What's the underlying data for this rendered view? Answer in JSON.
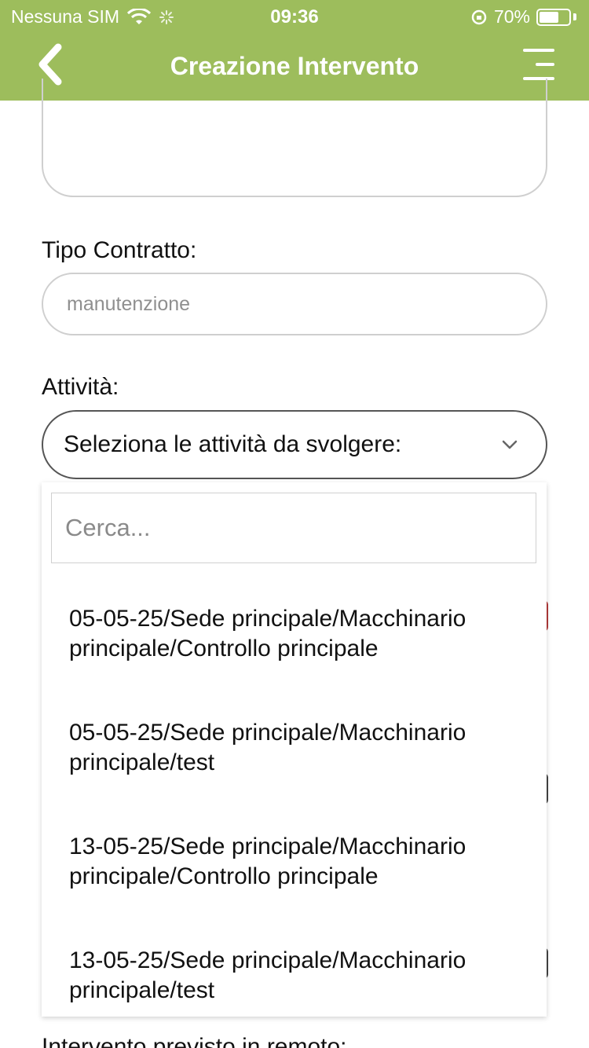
{
  "status_bar": {
    "carrier": "Nessuna SIM",
    "time": "09:36",
    "battery_percent": "70%",
    "battery_level": 0.7
  },
  "nav": {
    "title": "Creazione Intervento",
    "back_icon": "chevron-left-icon",
    "menu_icon": "menu-icon"
  },
  "form": {
    "tipo_contratto_label": "Tipo Contratto:",
    "tipo_contratto_placeholder": "manutenzione",
    "attivita_label": "Attività:",
    "attivita_select_value": "Seleziona le attività da svolgere:",
    "bottom_label": "Intervento previsto in remoto:"
  },
  "dropdown": {
    "search_placeholder": "Cerca...",
    "options": [
      {
        "line1": "05-05-25/Sede principale/Macchinario",
        "line2": "principale/Controllo principale"
      },
      {
        "line1": "05-05-25/Sede principale/Macchinario",
        "line2": "principale/test"
      },
      {
        "line1": "13-05-25/Sede principale/Macchinario",
        "line2": "principale/Controllo principale"
      },
      {
        "line1": "13-05-25/Sede principale/Macchinario",
        "line2": "principale/test"
      }
    ]
  },
  "colors": {
    "header": "#9dbd5c",
    "accent_red": "#b23a3a"
  }
}
